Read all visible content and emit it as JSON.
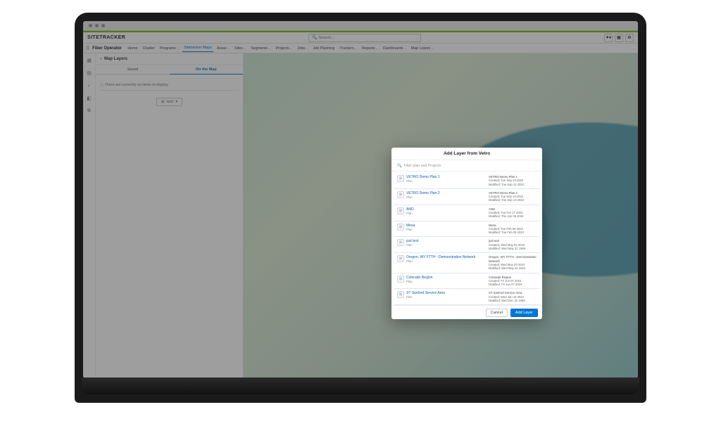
{
  "app": {
    "logo": "SITETRACKER"
  },
  "search": {
    "placeholder": "Search..."
  },
  "menu": {
    "brand": "Fiber Operator",
    "items": [
      {
        "label": "Home",
        "dropdown": false
      },
      {
        "label": "Chatter",
        "dropdown": false
      },
      {
        "label": "Programs",
        "dropdown": true
      },
      {
        "label": "Sitetracker Maps",
        "dropdown": false,
        "active": true
      },
      {
        "label": "Areas",
        "dropdown": true
      },
      {
        "label": "Sites",
        "dropdown": true
      },
      {
        "label": "Segments",
        "dropdown": true
      },
      {
        "label": "Projects",
        "dropdown": true
      },
      {
        "label": "Jobs",
        "dropdown": true
      },
      {
        "label": "Job Planning",
        "dropdown": false
      },
      {
        "label": "Trackers",
        "dropdown": true
      },
      {
        "label": "Reports",
        "dropdown": true
      },
      {
        "label": "Dashboards",
        "dropdown": true
      },
      {
        "label": "Map Layers",
        "dropdown": true
      }
    ]
  },
  "layers": {
    "title": "Map Layers",
    "tabs": {
      "saved": "Saved",
      "onmap": "On the Map"
    },
    "empty": "There are currently no items to display.",
    "add": "Add"
  },
  "modal": {
    "title": "Add Layer from Vetro",
    "search_placeholder": "Filter plan and Projects",
    "cancel": "Cancel",
    "submit": "Add Layer",
    "rows": [
      {
        "name": "VETRO Demo Plan 1",
        "type": "Plan",
        "detail_title": "VETRO Demo Plan 1",
        "created": "Created: Tue Sep 13 2022",
        "modified": "Modified: Tue Sep 13 2022"
      },
      {
        "name": "VETRO Demo Plan 2",
        "type": "Plan",
        "detail_title": "VETRO Demo Plan 2",
        "created": "Created: Tue Sep 13 2022",
        "modified": "Modified: Tue Sep 13 2022"
      },
      {
        "name": "AND",
        "type": "Plan",
        "detail_title": "AND",
        "created": "Created: Tue Oct 17 2023",
        "modified": "Modified: Thu Jun 06 2024"
      },
      {
        "name": "Mesa",
        "type": "Plan",
        "detail_title": "Mesa",
        "created": "Created: Tue Feb 06 2024",
        "modified": "Modified: Tue Feb 06 2024"
      },
      {
        "name": "just test",
        "type": "Plan",
        "detail_title": "just test",
        "created": "Created: Wed May 03 2023",
        "modified": "Modified: Wed May 31 1995"
      },
      {
        "name": "Oregon, WY FTTH - Demonstration Network",
        "type": "Plan",
        "detail_title": "Oregon, WY FTTH - Demonstration Network",
        "created": "Created: Wed May 03 2023",
        "modified": "Modified: Wed May 24 2024"
      },
      {
        "name": "Colorado Region",
        "type": "Plan",
        "detail_title": "Colorado Region",
        "created": "Created: Fri Jun 07 2024",
        "modified": "Modified: Fri Jun 07 2024"
      },
      {
        "name": "ST Sanford Service Area",
        "type": "Plan",
        "detail_title": "ST Sanford Service Area",
        "created": "Created: Wed Jan 10 2024",
        "modified": "Modified: Wed Dec 31 1969"
      }
    ]
  }
}
